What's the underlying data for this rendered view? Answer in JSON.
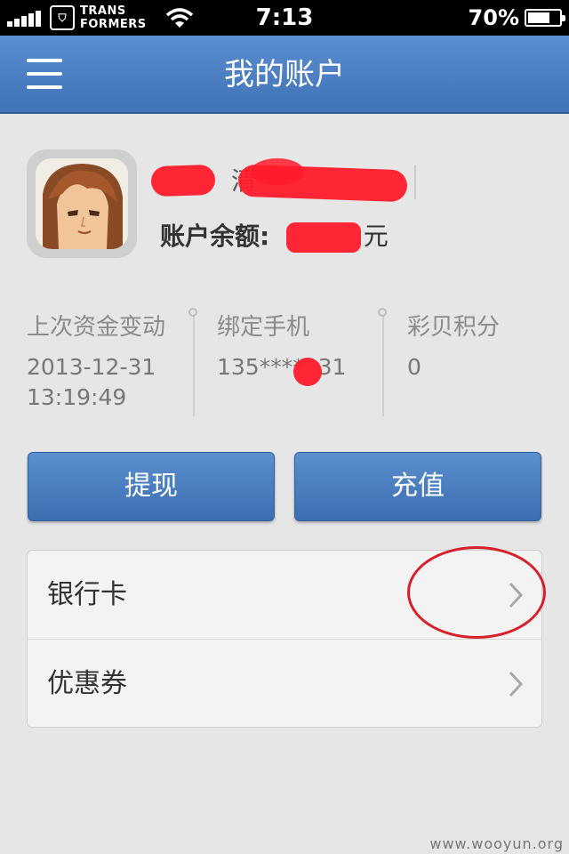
{
  "status_bar": {
    "carrier": "TRANS\nFORMERS",
    "time": "7:13",
    "battery_percent": "70%",
    "battery_level": 0.7,
    "signal_icon": "signal-bars-icon",
    "wifi_icon": "wifi-icon"
  },
  "navbar": {
    "title": "我的账户",
    "menu_icon": "hamburger-menu-icon"
  },
  "profile": {
    "name": "清",
    "balance_label": "账户余额:",
    "balance_unit": "元"
  },
  "info": {
    "last_change_label": "上次资金变动",
    "last_change_date": "2013-12-31",
    "last_change_time": "13:19:49",
    "phone_label": "绑定手机",
    "phone_value": "135****  31",
    "points_label": "彩贝积分",
    "points_value": "0"
  },
  "buttons": {
    "withdraw": "提现",
    "recharge": "充值"
  },
  "list": {
    "bank_card": "银行卡",
    "coupon": "优惠券"
  },
  "watermark": "www.wooyun.org",
  "colors": {
    "nav_blue": "#4a80c4",
    "button_blue": "#4a7ec2",
    "background": "#e6e6e6",
    "redaction": "#ff1a2a",
    "annotation_red": "#d8202b"
  }
}
